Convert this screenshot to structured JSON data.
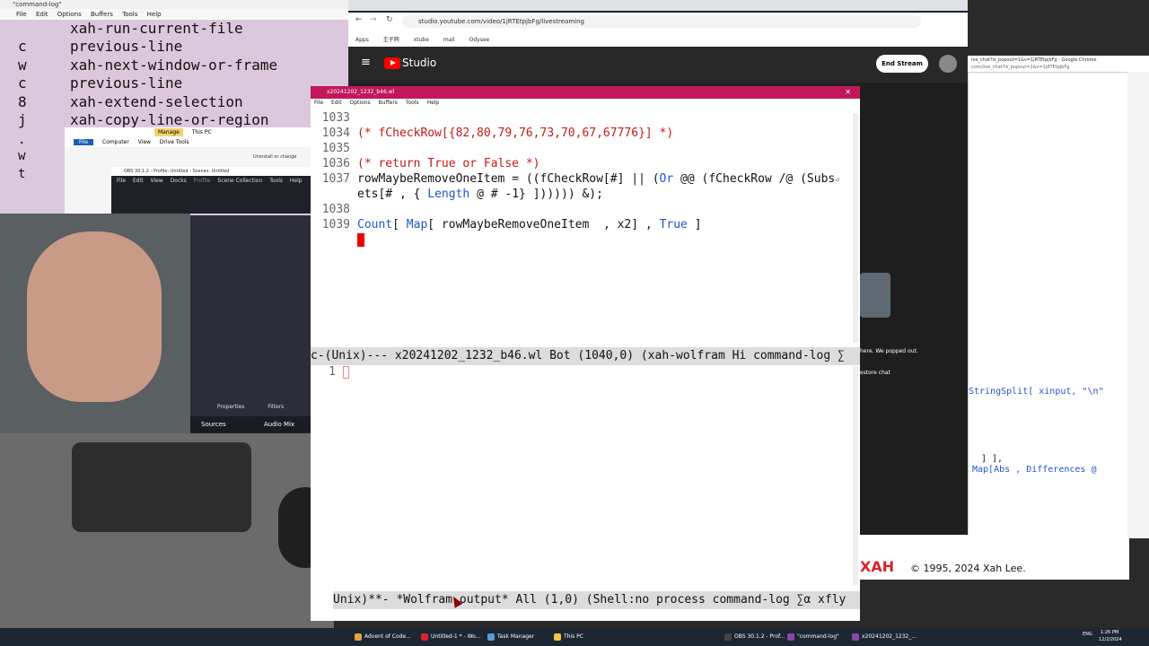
{
  "cmdlog": {
    "title": "\"command-log\"",
    "menu": [
      "File",
      "Edit",
      "Options",
      "Buffers",
      "Tools",
      "Help"
    ],
    "rows": [
      {
        "key": "",
        "cmd": "xah-run-current-file"
      },
      {
        "key": "c",
        "cmd": "previous-line"
      },
      {
        "key": "w",
        "cmd": "xah-next-window-or-frame"
      },
      {
        "key": "c",
        "cmd": "previous-line"
      },
      {
        "key": "8",
        "cmd": "xah-extend-selection"
      },
      {
        "key": "j",
        "cmd": "xah-copy-line-or-region"
      }
    ],
    "extra_keys": [
      ".",
      "w",
      "t"
    ]
  },
  "chrome": {
    "url": "studio.youtube.com/video/1jRTEtpjbFg/livestreaming",
    "bookmarks": [
      "Apps",
      "圭子网",
      "xtube",
      "mail",
      "Odysee"
    ],
    "studio_label": "Studio",
    "end_stream": "End Stream"
  },
  "emacs": {
    "title": "x20241202_1232_b46.wl",
    "menu": [
      "File",
      "Edit",
      "Options",
      "Buffers",
      "Tools",
      "Help"
    ],
    "lines": [
      {
        "n": "1033",
        "text": ""
      },
      {
        "n": "1034",
        "text": "(* fCheckRow[{82,80,79,76,73,70,67,67776}] *)"
      },
      {
        "n": "1035",
        "text": ""
      },
      {
        "n": "1036",
        "text": "(* return True or False *)"
      },
      {
        "n": "1037",
        "a": "rowMaybeRemoveOneItem = ((fCheckRow[#] || (",
        "b": "Or",
        "c": " @@ (fCheckRow /@ (Subs",
        "d": "⏎"
      },
      {
        "n": "",
        "a": "ets[# , { ",
        "b": "Length",
        "c": " @ # -1} ]))))) &);"
      },
      {
        "n": "1038",
        "text": ""
      },
      {
        "n": "1039",
        "a": "",
        "b": "Count",
        "c": "[ ",
        "d": "Map",
        "e": "[ rowMaybeRemoveOneItem  , x2] , ",
        "f": "True",
        "g": " ]"
      }
    ],
    "modeline1": "c-(Unix)--- x20241202_1232_b46.wl Bot (1040,0) (xah-wolfram Hi command-log ∑",
    "line2_num": "1",
    "modeline2": "Unix)**- *Wolfram output* All (1,0) (Shell:no process command-log ∑α xfly"
  },
  "side": {
    "stringsplit": "StringSplit[ xinput, \"\\n\"",
    "close_bracket": "] ],",
    "map_abs": "Map[Abs , Differences @",
    "xah_logo": "XAH",
    "copyright": "© 1995, 2024 Xah Lee.",
    "popped": "here. We popped out.",
    "restore": "estore chat",
    "chat_url": "ive_chat?is_popout=1&v=1jRTEtpjbFg - Google Chrome",
    "chat_url2": "com/live_chat?is_popout=1&v=1jRTEtpjbFg"
  },
  "obs": {
    "title": "OBS 30.1.2 - Profile: Untitled - Scenes: Untitled",
    "menu": [
      "File",
      "Edit",
      "View",
      "Docks",
      "Profile",
      "Scene Collection",
      "Tools",
      "Help"
    ],
    "sources": "Sources",
    "audio": "Audio Mix",
    "properties": "Properties",
    "filters": "Filters"
  },
  "explorer": {
    "tabs": [
      "File",
      "Computer",
      "View",
      "Drive Tools"
    ],
    "manage": "Manage",
    "thispc": "This PC",
    "uninstall": "Uninstall or change"
  },
  "taskbar": {
    "items": [
      {
        "label": "Advent of Code...",
        "color": "#e6a23c"
      },
      {
        "label": "Untitled-1 * - Wo...",
        "color": "#d9232d"
      },
      {
        "label": "Task Manager",
        "color": "#5b9bd5"
      },
      {
        "label": "This PC",
        "color": "#f5c242"
      },
      {
        "label": "OBS 30.1.2 - Prof...",
        "color": "#444"
      },
      {
        "label": "\"command-log\"",
        "color": "#8e44ad"
      },
      {
        "label": "x20241202_1232_...",
        "color": "#8e44ad"
      }
    ],
    "time": "1:26 PM",
    "date": "12/2/2024",
    "lang": "ENG"
  }
}
